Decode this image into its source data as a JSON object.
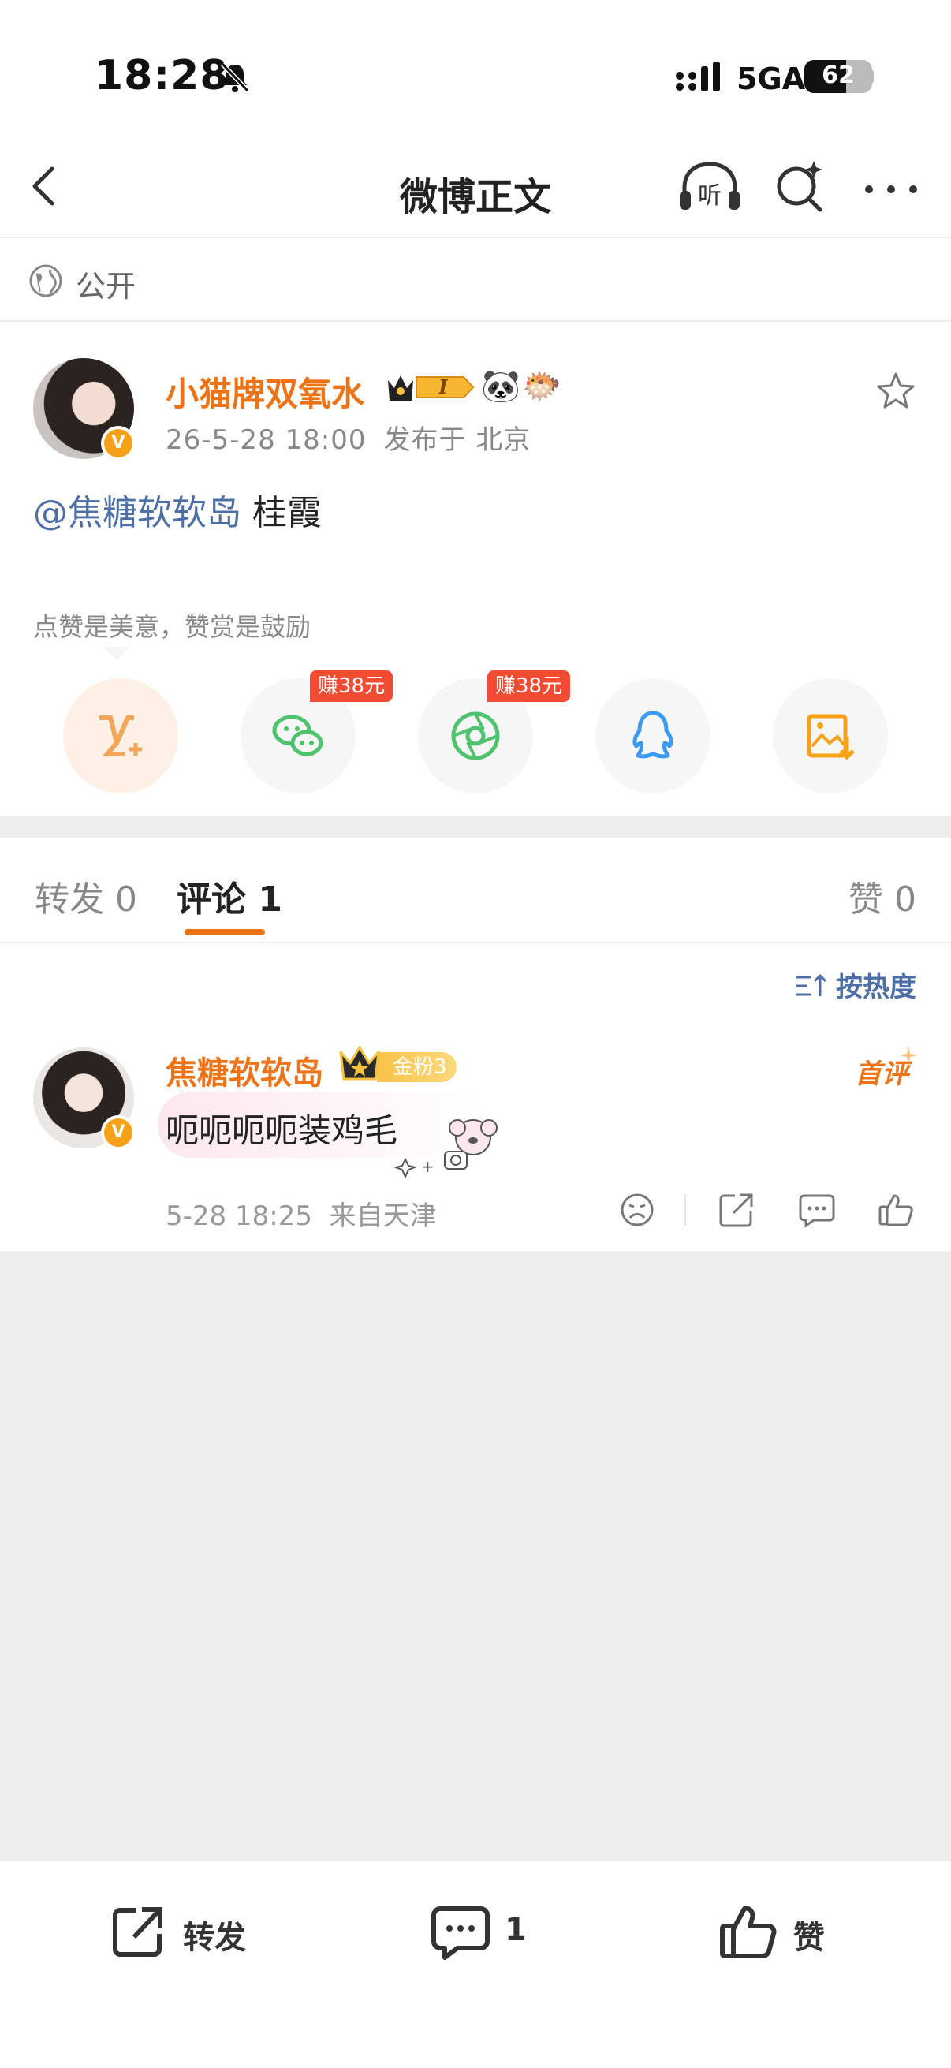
{
  "status_bar": {
    "time": "18:28",
    "network": "5GA",
    "battery": "62",
    "battery_level": 0.62,
    "icons": [
      "bell-muted-icon",
      "signal-icon",
      "battery-icon"
    ]
  },
  "nav": {
    "title": "微博正文",
    "icons": [
      "back-icon",
      "headphones-listen-icon",
      "search-sparkle-icon",
      "more-icon"
    ],
    "listen_label": "听"
  },
  "visibility": {
    "label": "公开",
    "icon": "globe-icon"
  },
  "post": {
    "author": "小猫牌双氧水",
    "verified_badge": "V",
    "member_level": "I",
    "emoji_badges": [
      "🐼",
      "🐡"
    ],
    "time": "26-5-28 18:00",
    "location": "发布于 北京",
    "mention": "@焦糖软软岛",
    "text": " 桂霞",
    "reward_hint": "点赞是美意，赞赏是鼓励",
    "share_options": [
      {
        "icon": "vip-reward-icon",
        "color": "#f2a65a"
      },
      {
        "icon": "wechat-icon",
        "color": "#4ec26d",
        "earn_tag": "赚38元"
      },
      {
        "icon": "moments-icon",
        "color": "#4ec26d",
        "earn_tag": "赚38元"
      },
      {
        "icon": "qq-icon",
        "color": "#3b9bf0"
      },
      {
        "icon": "save-image-icon",
        "color": "#f6a117"
      }
    ]
  },
  "tabs": {
    "repost": "转发 0",
    "comment": "评论 1",
    "like": "赞 0"
  },
  "comments": {
    "sort_label": "按热度",
    "items": [
      {
        "author": "焦糖软软岛",
        "fan_badge": "金粉3",
        "first_tag": "首评",
        "text": "呃呃呃呃装鸡毛",
        "time": "5-28 18:25",
        "source": "来自天津",
        "actions": [
          "dislike-icon",
          "share-icon",
          "comment-icon",
          "like-icon"
        ]
      }
    ]
  },
  "bottom_bar": {
    "repost_label": "转发",
    "comment_count": "1",
    "like_label": "赞"
  },
  "colors": {
    "accent": "#ee7316",
    "link": "#4d6fa6",
    "earn_tag": "#f24b33"
  }
}
